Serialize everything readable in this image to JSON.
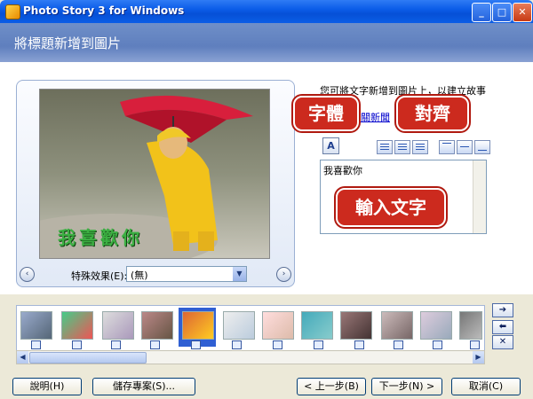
{
  "window": {
    "title": "Photo Story 3 for Windows",
    "minimize": "_",
    "maximize": "□",
    "close": "✕"
  },
  "header": {
    "title": "將標題新增到圖片"
  },
  "preview": {
    "caption": "我喜歡你",
    "prev": "‹",
    "next": "›",
    "effect_label": "特殊效果(E):",
    "effect_value": "(無)"
  },
  "text_panel": {
    "instructions": "您可將文字新增到圖片上，以建立故事的",
    "link": "關新聞",
    "text_value": "我喜歡你",
    "font_button": "A"
  },
  "callouts": {
    "font": "字體",
    "align": "對齊",
    "input": "輸入文字"
  },
  "filmstrip": {
    "count": 12,
    "selected_index": 4
  },
  "side_buttons": {
    "right": "➔",
    "left": "⬅",
    "remove": "✕"
  },
  "buttons": {
    "help": "說明(H)",
    "save": "儲存專案(S)...",
    "back": "< 上一步(B)",
    "next": "下一步(N) >",
    "cancel": "取消(C)"
  },
  "colors": {
    "callout_red": "#cc2a1e",
    "header_blue": "#6f8fc8",
    "caption_green": "#3cb043"
  }
}
